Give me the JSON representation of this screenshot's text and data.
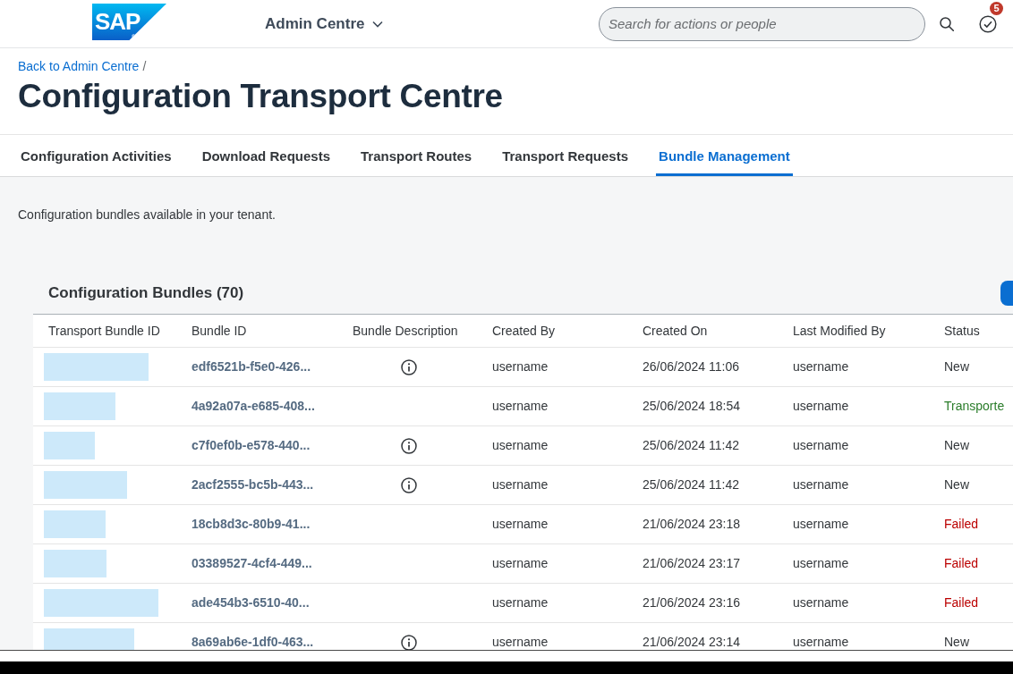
{
  "header": {
    "logo": {
      "text": "SAP",
      "registered": "®"
    },
    "app_menu": {
      "label": "Admin Centre"
    },
    "search": {
      "placeholder": "Search for actions or people"
    },
    "notifications": {
      "badge": "5"
    }
  },
  "breadcrumb": {
    "link": "Back to Admin Centre",
    "separator": "/"
  },
  "page_title": "Configuration Transport Centre",
  "tabs": [
    {
      "label": "Configuration Activities",
      "selected": false
    },
    {
      "label": "Download Requests",
      "selected": false
    },
    {
      "label": "Transport Routes",
      "selected": false
    },
    {
      "label": "Transport Requests",
      "selected": false
    },
    {
      "label": "Bundle Management",
      "selected": true
    }
  ],
  "description": "Configuration bundles available in your tenant.",
  "table": {
    "title": "Configuration Bundles (70)",
    "columns": [
      "Transport Bundle ID",
      "Bundle ID",
      "Bundle Description",
      "Created By",
      "Created On",
      "Last Modified By",
      "Status"
    ],
    "rows": [
      {
        "bundle_id": "edf6521b-f5e0-426...",
        "info_icon": true,
        "created_by": "username",
        "created_on": "26/06/2024 11:06",
        "last_modified_by": "username",
        "status": {
          "text": "New",
          "color": "#32363a"
        }
      },
      {
        "bundle_id": "4a92a07a-e685-408...",
        "info_icon": false,
        "created_by": "username",
        "created_on": "25/06/2024 18:54",
        "last_modified_by": "username",
        "status": {
          "text": "Transporte",
          "color": "#2b7d2b"
        }
      },
      {
        "bundle_id": "c7f0ef0b-e578-440...",
        "info_icon": true,
        "created_by": "username",
        "created_on": "25/06/2024 11:42",
        "last_modified_by": "username",
        "status": {
          "text": "New",
          "color": "#32363a"
        }
      },
      {
        "bundle_id": "2acf2555-bc5b-443...",
        "info_icon": true,
        "created_by": "username",
        "created_on": "25/06/2024 11:42",
        "last_modified_by": "username",
        "status": {
          "text": "New",
          "color": "#32363a"
        }
      },
      {
        "bundle_id": "18cb8d3c-80b9-41...",
        "info_icon": false,
        "created_by": "username",
        "created_on": "21/06/2024 23:18",
        "last_modified_by": "username",
        "status": {
          "text": "Failed",
          "color": "#bb0000"
        }
      },
      {
        "bundle_id": "03389527-4cf4-449...",
        "info_icon": false,
        "created_by": "username",
        "created_on": "21/06/2024 23:17",
        "last_modified_by": "username",
        "status": {
          "text": "Failed",
          "color": "#bb0000"
        }
      },
      {
        "bundle_id": "ade454b3-6510-40...",
        "info_icon": false,
        "created_by": "username",
        "created_on": "21/06/2024 23:16",
        "last_modified_by": "username",
        "status": {
          "text": "Failed",
          "color": "#bb0000"
        }
      },
      {
        "bundle_id": "8a69ab6e-1df0-463...",
        "info_icon": true,
        "created_by": "username",
        "created_on": "21/06/2024 23:14",
        "last_modified_by": "username",
        "status": {
          "text": "New",
          "color": "#32363a"
        }
      }
    ]
  }
}
